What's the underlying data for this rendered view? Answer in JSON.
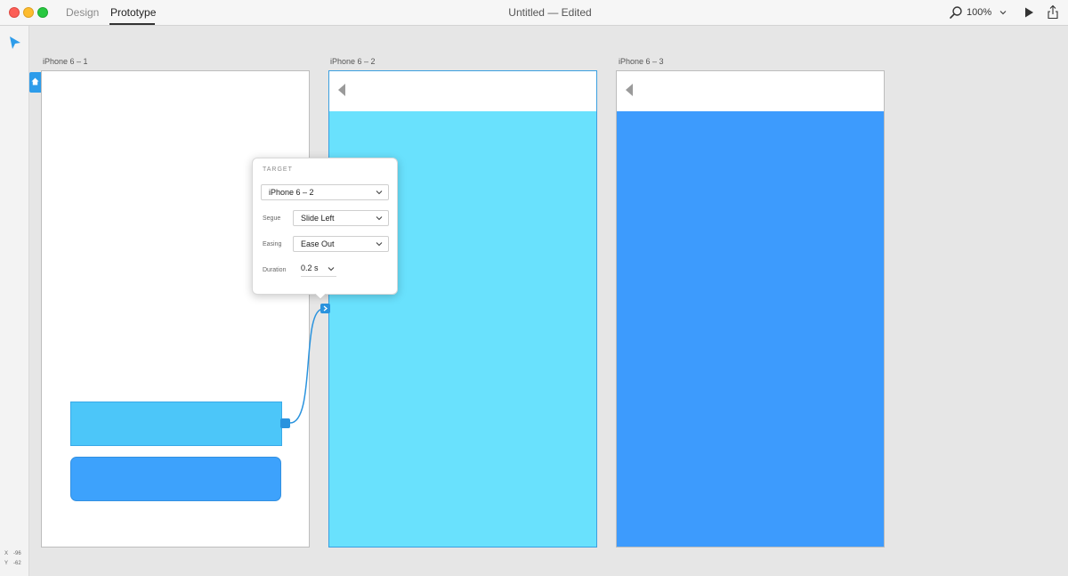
{
  "window": {
    "title": "Untitled — Edited"
  },
  "modes": {
    "design": "Design",
    "prototype": "Prototype"
  },
  "toolbar": {
    "zoom": "100%"
  },
  "coords": {
    "x_label": "X",
    "x_value": "-96",
    "y_label": "Y",
    "y_value": "-62"
  },
  "artboards": [
    {
      "name": "iPhone 6 – 1"
    },
    {
      "name": "iPhone 6 – 2"
    },
    {
      "name": "iPhone 6 – 3"
    }
  ],
  "popover": {
    "heading": "TARGET",
    "target": "iPhone 6 – 2",
    "segue_label": "Segue",
    "segue": "Slide Left",
    "easing_label": "Easing",
    "easing": "Ease Out",
    "duration_label": "Duration",
    "duration": "0.2 s"
  },
  "colors": {
    "accent": "#2d9cea",
    "artboard2_fill": "#69e1fd",
    "artboard3_fill": "#3d9bfd",
    "rect_selected": "#4cc6f9",
    "rect_rounded": "#3da2fc"
  },
  "icons": [
    "search-icon",
    "chevron-down-icon",
    "play-icon",
    "share-icon",
    "select-arrow-icon",
    "home-icon",
    "back-arrow-icon"
  ]
}
